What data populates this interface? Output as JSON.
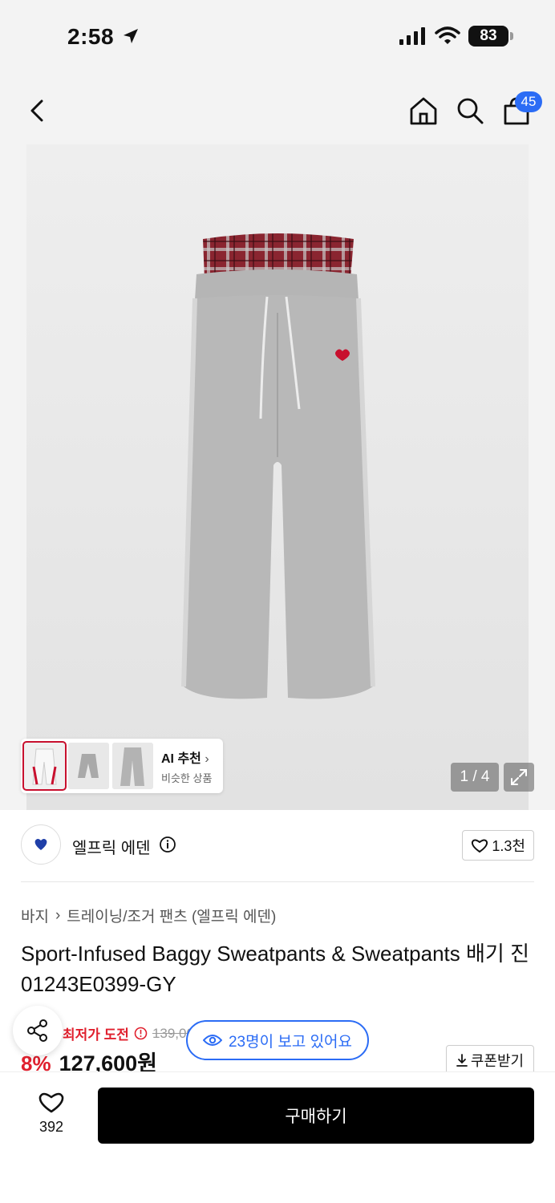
{
  "status_bar": {
    "time": "2:58",
    "battery": "83"
  },
  "nav": {
    "cart_count": "45"
  },
  "gallery": {
    "ai_title": "AI 추천",
    "ai_subtitle": "비슷한 상품",
    "page_indicator": "1 / 4"
  },
  "brand": {
    "name": "엘프릭 에덴",
    "likes": "1.3천"
  },
  "product": {
    "breadcrumb": [
      "바지",
      "트레이닝/조거 팬츠 (엘프릭 에덴)"
    ],
    "title": "Sport-Infused Baggy Sweatpants & Sweatpants 배기 진 01243E0399-GY",
    "price_label": "최저가 도전",
    "original_price": "139,00",
    "discount": "8%",
    "final_price": "127,600원",
    "viewers_text": "23명이 보고 있어요",
    "coupon_label": "쿠폰받기"
  },
  "bottom_bar": {
    "wish_count": "392",
    "buy_label": "구매하기"
  },
  "colors": {
    "accent_blue": "#2b6cf5",
    "sale_red": "#e0202e",
    "buy_black": "#000000"
  }
}
